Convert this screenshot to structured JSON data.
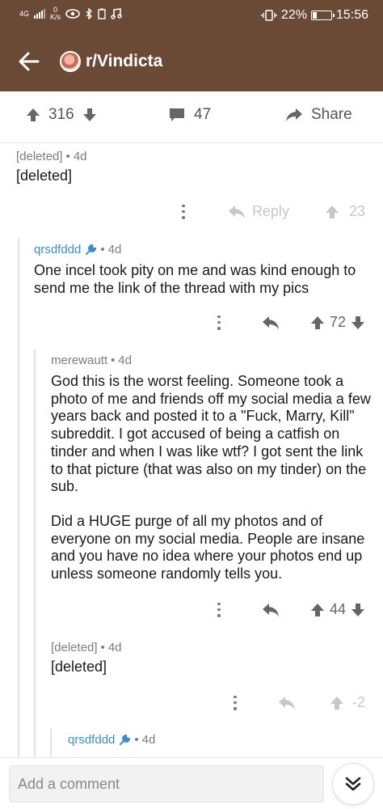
{
  "status": {
    "network": "4G",
    "speed_value": "0",
    "speed_unit": "K/s",
    "battery": "22%",
    "battery_level": 0.22,
    "time": "15:56"
  },
  "header": {
    "subreddit": "r/Vindicta"
  },
  "post_actions": {
    "score": "316",
    "comments": "47",
    "share": "Share"
  },
  "comments": [
    {
      "author": "[deleted]",
      "age": "4d",
      "body": [
        "[deleted]"
      ],
      "reply": "Reply",
      "score": "23"
    },
    {
      "author": "qrsdfddd",
      "age": "4d",
      "body": [
        "One incel took pity on me and was kind enough to send me the link of the thread with my pics"
      ],
      "score": "72"
    },
    {
      "author": "merewautt",
      "age": "4d",
      "body": [
        "God this is the worst feeling. Someone took a photo of me and friends off my social media a few years back and posted it to a \"Fuck, Marry, Kill\" subreddit. I got accused of being a catfish on tinder and when I was like wtf? I got sent the link to that picture (that was also on my tinder) on the sub.",
        "Did a HUGE purge of all my photos and of everyone on my social media. People are insane and you have no idea where your photos end up unless someone randomly tells you."
      ],
      "score": "44"
    },
    {
      "author": "[deleted]",
      "age": "4d",
      "body": [
        "[deleted]"
      ],
      "score": "-2"
    },
    {
      "author": "qrsdfddd",
      "age": "4d"
    }
  ],
  "bottom": {
    "placeholder": "Add a comment"
  },
  "colors": {
    "header_bg": "#6b4a35",
    "username": "#3b8fc4",
    "thread_line": "#e2e2e2"
  }
}
